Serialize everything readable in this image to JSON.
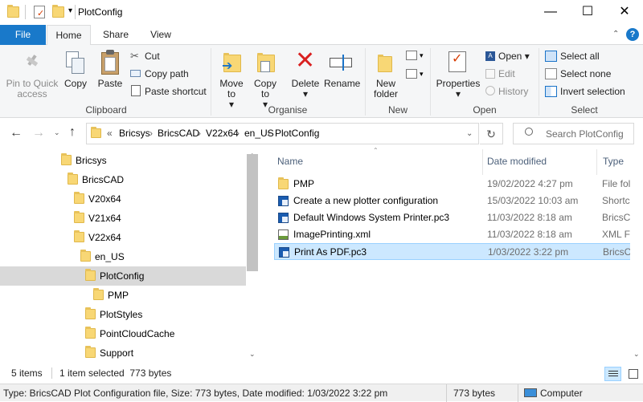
{
  "title": "PlotConfig",
  "window_controls": {
    "minimize": "—",
    "maximize": "☐",
    "close": "✕"
  },
  "tabs": {
    "file": "File",
    "home": "Home",
    "share": "Share",
    "view": "View"
  },
  "ribbon": {
    "clipboard": {
      "pin": "Pin to Quick access",
      "copy": "Copy",
      "paste": "Paste",
      "cut": "Cut",
      "copy_path": "Copy path",
      "paste_shortcut": "Paste shortcut",
      "label": "Clipboard"
    },
    "organise": {
      "move_to": "Move to",
      "copy_to": "Copy to",
      "delete": "Delete",
      "rename": "Rename",
      "label": "Organise"
    },
    "new": {
      "new_folder": "New folder",
      "label": "New"
    },
    "open": {
      "properties": "Properties",
      "open": "Open",
      "edit": "Edit",
      "history": "History",
      "label": "Open"
    },
    "select": {
      "select_all": "Select all",
      "select_none": "Select none",
      "invert": "Invert selection",
      "label": "Select"
    }
  },
  "address": {
    "crumbs": [
      "Bricsys",
      "BricsCAD",
      "V22x64",
      "en_US",
      "PlotConfig"
    ],
    "overflow": "«",
    "search_placeholder": "Search PlotConfig"
  },
  "tree": [
    {
      "label": "Bricsys",
      "indent": 0
    },
    {
      "label": "BricsCAD",
      "indent": 1
    },
    {
      "label": "V20x64",
      "indent": 2
    },
    {
      "label": "V21x64",
      "indent": 2
    },
    {
      "label": "V22x64",
      "indent": 2
    },
    {
      "label": "en_US",
      "indent": 3
    },
    {
      "label": "PlotConfig",
      "indent": 4
    },
    {
      "label": "PMP",
      "indent": 5
    },
    {
      "label": "PlotStyles",
      "indent": 4
    },
    {
      "label": "PointCloudCache",
      "indent": 4
    },
    {
      "label": "Support",
      "indent": 4
    }
  ],
  "columns": {
    "name": "Name",
    "date": "Date modified",
    "type": "Type"
  },
  "files": [
    {
      "name": "PMP",
      "date": "19/02/2022 4:27 pm",
      "type": "File folder",
      "icon": "folder-icon"
    },
    {
      "name": "Create a new plotter configuration",
      "date": "15/03/2022 10:03 am",
      "type": "Shortcut",
      "icon": "shortcut-icon"
    },
    {
      "name": "Default Windows System Printer.pc3",
      "date": "11/03/2022 8:18 am",
      "type": "BricsCAD",
      "icon": "pc3-file-icon"
    },
    {
      "name": "ImagePrinting.xml",
      "date": "11/03/2022 8:18 am",
      "type": "XML File",
      "icon": "xml-file-icon"
    },
    {
      "name": "Print As PDF.pc3",
      "date": "1/03/2022 3:22 pm",
      "type": "BricsCAD",
      "icon": "pc3-file-icon",
      "selected": true
    }
  ],
  "status": {
    "items": "5 items",
    "selected": "1 item selected  773 bytes"
  },
  "infobar": {
    "details": "Type: BricsCAD Plot Configuration file, Size: 773 bytes, Date modified: 1/03/2022 3:22 pm",
    "size": "773 bytes",
    "location": "Computer"
  },
  "colors": {
    "accent": "#1979ca",
    "selection": "#cce8ff",
    "folder": "#f8d775"
  }
}
